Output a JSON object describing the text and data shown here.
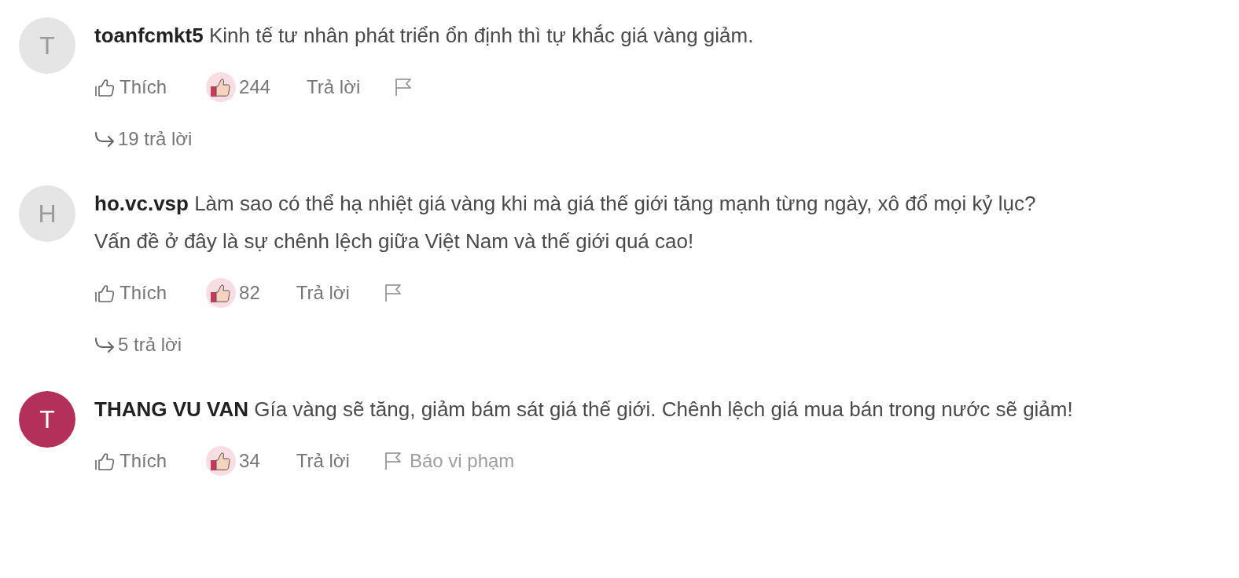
{
  "comments": [
    {
      "avatar": {
        "letter": "T",
        "color": "#e5e5e5"
      },
      "author": "toanfcmkt5",
      "text": "Kinh tế tư nhân phát triển ổn định thì tự khắc giá vàng giảm.",
      "like_label": "Thích",
      "like_count": "244",
      "reply_label": "Trả lời",
      "replies": "19 trả lời"
    },
    {
      "avatar": {
        "letter": "H",
        "color": "#e5e5e5"
      },
      "author": "ho.vc.vsp",
      "text": "Làm sao có thể hạ nhiệt giá vàng khi mà giá thế giới tăng mạnh từng ngày, xô đổ mọi kỷ lục?\nVấn đề ở đây là sự chênh lệch giữa Việt Nam và thế giới quá cao!",
      "like_label": "Thích",
      "like_count": "82",
      "reply_label": "Trả lời",
      "replies": "5 trả lời"
    },
    {
      "avatar": {
        "letter": "T",
        "color": "#b3305a"
      },
      "author": "THANG VU VAN",
      "text": "Gía vàng sẽ tăng, giảm bám sát giá thế giới. Chênh lệch giá mua bán trong nước sẽ giảm!",
      "like_label": "Thích",
      "like_count": "34",
      "reply_label": "Trả lời",
      "report_label": "Báo vi phạm"
    }
  ]
}
